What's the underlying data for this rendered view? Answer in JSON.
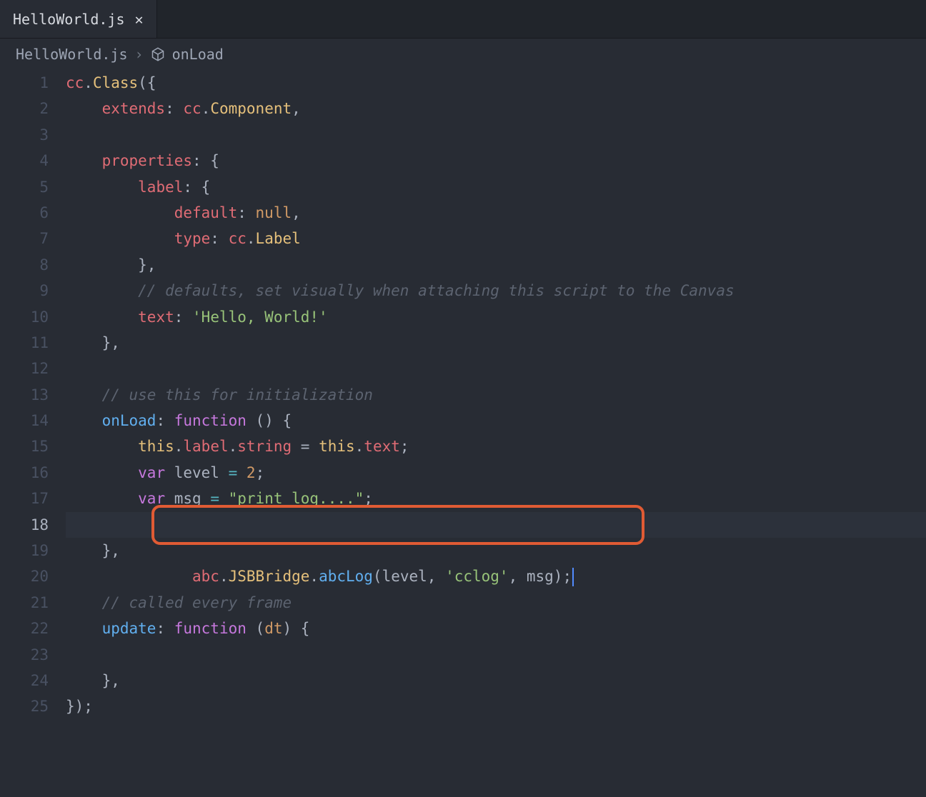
{
  "tab": {
    "label": "HelloWorld.js",
    "close": "✕"
  },
  "breadcrumb": {
    "file": "HelloWorld.js",
    "sep": "›",
    "symbol": "onLoad"
  },
  "gutter": [
    "1",
    "2",
    "3",
    "4",
    "5",
    "6",
    "7",
    "8",
    "9",
    "10",
    "11",
    "12",
    "13",
    "14",
    "15",
    "16",
    "17",
    "18",
    "19",
    "20",
    "21",
    "22",
    "23",
    "24",
    "25"
  ],
  "code": {
    "l1": {
      "a": "cc",
      "b": ".",
      "c": "Class",
      "d": "({"
    },
    "l2": {
      "a": "extends",
      "b": ": ",
      "c": "cc",
      "d": ".",
      "e": "Component",
      "f": ","
    },
    "l4": {
      "a": "properties",
      "b": ": {"
    },
    "l5": {
      "a": "label",
      "b": ": {"
    },
    "l6": {
      "a": "default",
      "b": ": ",
      "c": "null",
      "d": ","
    },
    "l7": {
      "a": "type",
      "b": ": ",
      "c": "cc",
      "d": ".",
      "e": "Label"
    },
    "l8": {
      "a": "},"
    },
    "l9": {
      "a": "// defaults, set visually when attaching this script to the Canvas"
    },
    "l10": {
      "a": "text",
      "b": ": ",
      "c": "'Hello, World!'"
    },
    "l11": {
      "a": "},"
    },
    "l13": {
      "a": "// use this for initialization"
    },
    "l14": {
      "a": "onLoad",
      "b": ": ",
      "c": "function",
      "d": " () {"
    },
    "l15": {
      "a": "this",
      "b": ".",
      "c": "label",
      "d": ".",
      "e": "string",
      "f": " = ",
      "g": "this",
      "h": ".",
      "i": "text",
      "j": ";"
    },
    "l16": {
      "a": "var",
      "b": " level ",
      "c": "=",
      "d": " ",
      "e": "2",
      "f": ";"
    },
    "l17": {
      "a": "var",
      "b": " msg ",
      "c": "=",
      "d": " ",
      "e": "\"print log....\"",
      "f": ";"
    },
    "l18": {
      "a": "abc",
      "b": ".",
      "c": "JSBBridge",
      "d": ".",
      "e": "abcLog",
      "f": "(level, ",
      "g": "'cclog'",
      "h": ", msg);"
    },
    "l19": {
      "a": "},"
    },
    "l21": {
      "a": "// called every frame"
    },
    "l22": {
      "a": "update",
      "b": ": ",
      "c": "function",
      "d": " (",
      "e": "dt",
      "f": ") {"
    },
    "l24": {
      "a": "},"
    },
    "l25": {
      "a": "});"
    }
  },
  "indent": {
    "i1": "    ",
    "i2": "        ",
    "i3": "            "
  }
}
